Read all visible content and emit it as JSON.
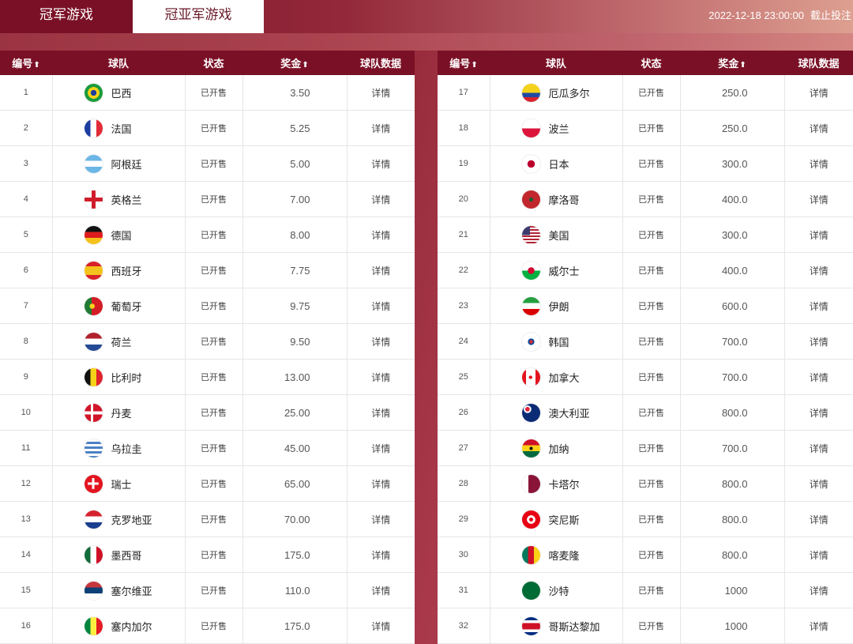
{
  "tabs": [
    {
      "label": "冠军游戏"
    },
    {
      "label": "冠亚军游戏"
    }
  ],
  "deadline": {
    "datetime": "2022-12-18 23:00:00",
    "label": "截止投注"
  },
  "headers": {
    "num": "编号",
    "team": "球队",
    "status": "状态",
    "prize": "奖金",
    "data": "球队数据",
    "sort_arrow": "⬆"
  },
  "left_rows": [
    {
      "num": "1",
      "team": "巴西",
      "status": "已开售",
      "prize": "3.50",
      "detail": "详情",
      "flag": "brazil-flag-icon",
      "bg": "radial-gradient(circle at 50% 50%, #1d3e9a 0 22%, #f5d21a 23% 45%, #1a9b3c 46%)"
    },
    {
      "num": "2",
      "team": "法国",
      "status": "已开售",
      "prize": "5.25",
      "detail": "详情",
      "flag": "france-flag-icon",
      "bg": "linear-gradient(90deg,#1b3da0 0 33%,#fff 33% 66%,#e12b36 66%)"
    },
    {
      "num": "3",
      "team": "阿根廷",
      "status": "已开售",
      "prize": "5.00",
      "detail": "详情",
      "flag": "argentina-flag-icon",
      "bg": "linear-gradient(180deg,#6cb6e6 0 33%,#fff 33% 66%,#6cb6e6 66%)"
    },
    {
      "num": "4",
      "team": "英格兰",
      "status": "已开售",
      "prize": "7.00",
      "detail": "详情",
      "flag": "england-flag-icon",
      "bg": "linear-gradient(90deg,transparent 40%,#d01c2a 40% 60%,transparent 60%),linear-gradient(180deg,#fff 40%,#d01c2a 40% 60%,#fff 60%)"
    },
    {
      "num": "5",
      "team": "德国",
      "status": "已开售",
      "prize": "8.00",
      "detail": "详情",
      "flag": "germany-flag-icon",
      "bg": "linear-gradient(180deg,#111 0 33%,#dd1d1d 33% 66%,#f5c21a 66%)"
    },
    {
      "num": "6",
      "team": "西班牙",
      "status": "已开售",
      "prize": "7.75",
      "detail": "详情",
      "flag": "spain-flag-icon",
      "bg": "linear-gradient(180deg,#d8202a 0 27%,#f4c21c 27% 73%,#d8202a 73%)"
    },
    {
      "num": "7",
      "team": "葡萄牙",
      "status": "已开售",
      "prize": "9.75",
      "detail": "详情",
      "flag": "portugal-flag-icon",
      "bg": "radial-gradient(circle at 42% 50%,#f5d21a 0 18%,transparent 19%),linear-gradient(90deg,#1f7a33 0 40%,#d41c25 40%)"
    },
    {
      "num": "8",
      "team": "荷兰",
      "status": "已开售",
      "prize": "9.50",
      "detail": "详情",
      "flag": "netherlands-flag-icon",
      "bg": "linear-gradient(180deg,#b1202c 0 33%,#fff 33% 66%,#254a96 66%)"
    },
    {
      "num": "9",
      "team": "比利时",
      "status": "已开售",
      "prize": "13.00",
      "detail": "详情",
      "flag": "belgium-flag-icon",
      "bg": "linear-gradient(90deg,#111 0 33%,#f5d21a 33% 66%,#e0232c 66%)"
    },
    {
      "num": "10",
      "team": "丹麦",
      "status": "已开售",
      "prize": "25.00",
      "detail": "详情",
      "flag": "denmark-flag-icon",
      "bg": "linear-gradient(90deg,transparent 34%,#fff 34% 48%,transparent 48%),linear-gradient(180deg,#d1152a 42%,#fff 42% 58%,#d1152a 58%)"
    },
    {
      "num": "11",
      "team": "乌拉圭",
      "status": "已开售",
      "prize": "45.00",
      "detail": "详情",
      "flag": "uruguay-flag-icon",
      "bg": "repeating-linear-gradient(180deg,#fff 0 3px,#4b82c4 3px 6px)"
    },
    {
      "num": "12",
      "team": "瑞士",
      "status": "已开售",
      "prize": "65.00",
      "detail": "详情",
      "flag": "switzerland-flag-icon",
      "bg": "linear-gradient(90deg,transparent 40%,#fff 40% 60%,transparent 60%) center/60% 60% no-repeat,linear-gradient(180deg,transparent 40%,#fff 40% 60%,transparent 60%) center/60% 60% no-repeat,#e3141f"
    },
    {
      "num": "13",
      "team": "克罗地亚",
      "status": "已开售",
      "prize": "70.00",
      "detail": "详情",
      "flag": "croatia-flag-icon",
      "bg": "linear-gradient(180deg,#d5232e 0 33%,#fff 33% 66%,#1b3f8f 66%)"
    },
    {
      "num": "14",
      "team": "墨西哥",
      "status": "已开售",
      "prize": "175.0",
      "detail": "详情",
      "flag": "mexico-flag-icon",
      "bg": "linear-gradient(90deg,#146b3a 0 33%,#fff 33% 66%,#ce1126 66%)"
    },
    {
      "num": "15",
      "team": "塞尔维亚",
      "status": "已开售",
      "prize": "110.0",
      "detail": "详情",
      "flag": "serbia-flag-icon",
      "bg": "linear-gradient(180deg,#c6363c 0 33%,#0c4076 33% 66%,#fff 66%)"
    },
    {
      "num": "16",
      "team": "塞内加尔",
      "status": "已开售",
      "prize": "175.0",
      "detail": "详情",
      "flag": "senegal-flag-icon",
      "bg": "linear-gradient(90deg,#00853f 0 33%,#fdef42 33% 66%,#e31b23 66%)"
    }
  ],
  "right_rows": [
    {
      "num": "17",
      "team": "厄瓜多尔",
      "status": "已开售",
      "prize": "250.0",
      "detail": "详情",
      "flag": "ecuador-flag-icon",
      "bg": "linear-gradient(180deg,#f5d21a 0 50%,#1f4aa3 50% 75%,#d8232f 75%)"
    },
    {
      "num": "18",
      "team": "波兰",
      "status": "已开售",
      "prize": "250.0",
      "detail": "详情",
      "flag": "poland-flag-icon",
      "bg": "linear-gradient(180deg,#fff 0 50%,#dc143c 50%)"
    },
    {
      "num": "19",
      "team": "日本",
      "status": "已开售",
      "prize": "300.0",
      "detail": "详情",
      "flag": "japan-flag-icon",
      "bg": "radial-gradient(circle,#bc002d 0 28%,#fff 30%)"
    },
    {
      "num": "20",
      "team": "摩洛哥",
      "status": "已开售",
      "prize": "400.0",
      "detail": "详情",
      "flag": "morocco-flag-icon",
      "bg": "radial-gradient(circle,#006233 0 14%,#c1272d 16%)"
    },
    {
      "num": "21",
      "team": "美国",
      "status": "已开售",
      "prize": "300.0",
      "detail": "详情",
      "flag": "usa-flag-icon",
      "bg": "linear-gradient(#3c3b6e,#3c3b6e) 0 0/45% 50% no-repeat,repeating-linear-gradient(180deg,#b22234 0 2px,#fff 2px 4px)"
    },
    {
      "num": "22",
      "team": "威尔士",
      "status": "已开售",
      "prize": "400.0",
      "detail": "详情",
      "flag": "wales-flag-icon",
      "bg": "radial-gradient(circle,#d30731 0 25%,transparent 27%),linear-gradient(180deg,#fff 0 50%,#00b140 50%)"
    },
    {
      "num": "23",
      "team": "伊朗",
      "status": "已开售",
      "prize": "600.0",
      "detail": "详情",
      "flag": "iran-flag-icon",
      "bg": "linear-gradient(180deg,#239f40 0 33%,#fff 33% 66%,#da0000 66%)"
    },
    {
      "num": "24",
      "team": "韩国",
      "status": "已开售",
      "prize": "700.0",
      "detail": "详情",
      "flag": "korea-flag-icon",
      "bg": "radial-gradient(circle,#cd2e3a 0 14%,#0047a0 15% 24%,#fff 26%)"
    },
    {
      "num": "25",
      "team": "加拿大",
      "status": "已开售",
      "prize": "700.0",
      "detail": "详情",
      "flag": "canada-flag-icon",
      "bg": "radial-gradient(circle,#e3141f 0 16%,#fff 18%) center/50% 100% no-repeat,linear-gradient(90deg,#e3141f 0 25%,#fff 25% 75%,#e3141f 75%)"
    },
    {
      "num": "26",
      "team": "澳大利亚",
      "status": "已开售",
      "prize": "800.0",
      "detail": "详情",
      "flag": "australia-flag-icon",
      "bg": "radial-gradient(circle at 30% 30%,#e0203a 0 12%,#fff 13% 20%,transparent 22%),#0b2b75"
    },
    {
      "num": "27",
      "team": "加纳",
      "status": "已开售",
      "prize": "700.0",
      "detail": "详情",
      "flag": "ghana-flag-icon",
      "bg": "radial-gradient(circle,#111 0 12%,transparent 14%),linear-gradient(180deg,#ce1126 0 33%,#fcd116 33% 66%,#006b3f 66%)"
    },
    {
      "num": "28",
      "team": "卡塔尔",
      "status": "已开售",
      "prize": "800.0",
      "detail": "详情",
      "flag": "qatar-flag-icon",
      "bg": "linear-gradient(90deg,#fff 0 35%,#8a1538 35%)"
    },
    {
      "num": "29",
      "team": "突尼斯",
      "status": "已开售",
      "prize": "800.0",
      "detail": "详情",
      "flag": "tunisia-flag-icon",
      "bg": "radial-gradient(circle,#e70013 0 14%,#fff 16% 32%,#e70013 34%)"
    },
    {
      "num": "30",
      "team": "喀麦隆",
      "status": "已开售",
      "prize": "800.0",
      "detail": "详情",
      "flag": "cameroon-flag-icon",
      "bg": "linear-gradient(90deg,#007a5e 0 33%,#ce1126 33% 66%,#fcd116 66%)"
    },
    {
      "num": "31",
      "team": "沙特",
      "status": "已开售",
      "prize": "1000",
      "detail": "详情",
      "flag": "saudi-flag-icon",
      "bg": "#006c35"
    },
    {
      "num": "32",
      "team": "哥斯达黎加",
      "status": "已开售",
      "prize": "1000",
      "detail": "详情",
      "flag": "costa-rica-flag-icon",
      "bg": "linear-gradient(180deg,#002b7f 0 17%,#fff 17% 33%,#ce1126 33% 67%,#fff 67% 83%,#002b7f 83%)"
    }
  ]
}
